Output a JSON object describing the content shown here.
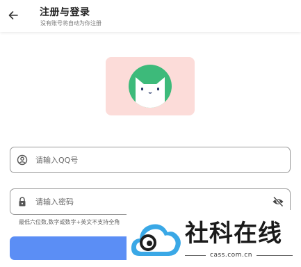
{
  "header": {
    "title": "注册与登录",
    "subtitle": "没有账号将自动为你注册"
  },
  "logo": {
    "card_color": "#fcdcd9",
    "circle_color": "#3dba7a",
    "icon": "cat-face-icon"
  },
  "form": {
    "qq_placeholder": "请输入QQ号",
    "password_placeholder": "请输入密码",
    "password_hint": "最低六位数,数字或数字+英文不支持全角",
    "submit_color": "#5b8ef5"
  },
  "watermark": {
    "name": "社科在线",
    "url": "cass.com.cn"
  }
}
